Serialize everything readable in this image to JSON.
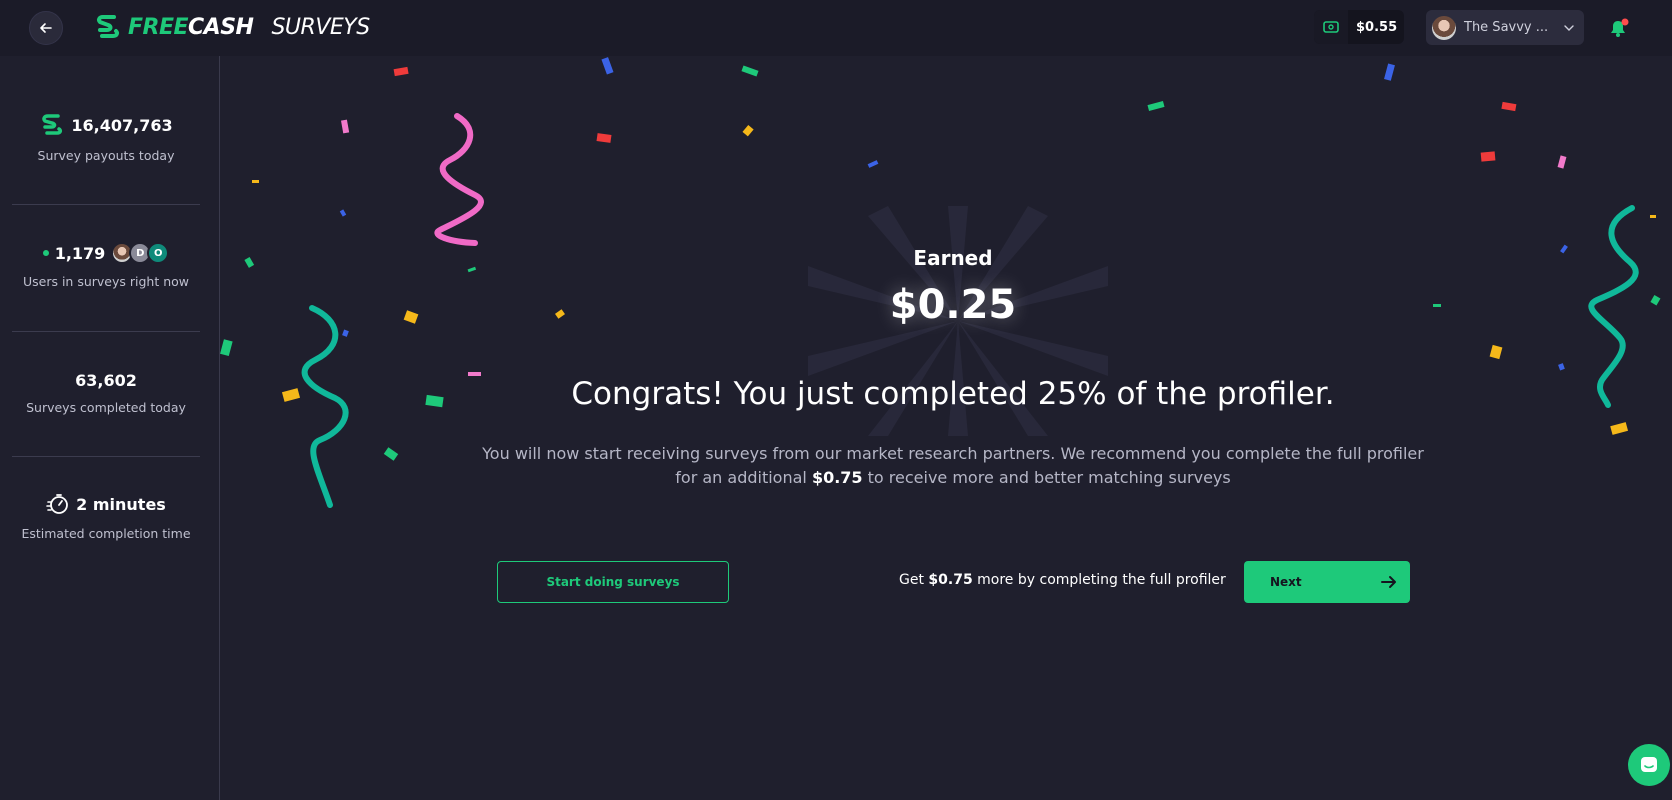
{
  "header": {
    "logo_free": "FREE",
    "logo_cash": "CASH",
    "logo_surveys": "SURVEYS",
    "balance": "$0.55",
    "user_name": "The Savvy ..."
  },
  "sidebar": {
    "stats": [
      {
        "value": "16,407,763",
        "label": "Survey payouts today"
      },
      {
        "value": "1,179",
        "label": "Users in surveys right now",
        "avatars": [
          "",
          "D",
          "O"
        ]
      },
      {
        "value": "63,602",
        "label": "Surveys completed today"
      },
      {
        "value": "2 minutes",
        "label": "Estimated completion time"
      }
    ]
  },
  "main": {
    "earned_label": "Earned",
    "earned_value": "$0.25",
    "congrats": "Congrats! You just completed 25% of the profiler.",
    "desc_part1": "You will now start receiving surveys from our market research partners. We recommend you complete the full profiler for an additional ",
    "desc_amount": "$0.75",
    "desc_part2": " to receive more and better matching surveys",
    "start_button": "Start doing surveys",
    "cta_prefix": "Get ",
    "cta_amount": "$0.75",
    "cta_suffix": " more by completing the full profiler",
    "next_button": "Next"
  },
  "colors": {
    "accent": "#1ec97a",
    "background": "#1f1f2d",
    "topbar": "#1b1b28",
    "notification_dot": "#ff4d4d"
  },
  "icons": [
    "back-arrow-icon",
    "freecash-logo-icon",
    "cash-icon",
    "chevron-down-icon",
    "bell-icon",
    "payout-icon",
    "stopwatch-icon",
    "arrow-right-icon",
    "chat-icon"
  ]
}
